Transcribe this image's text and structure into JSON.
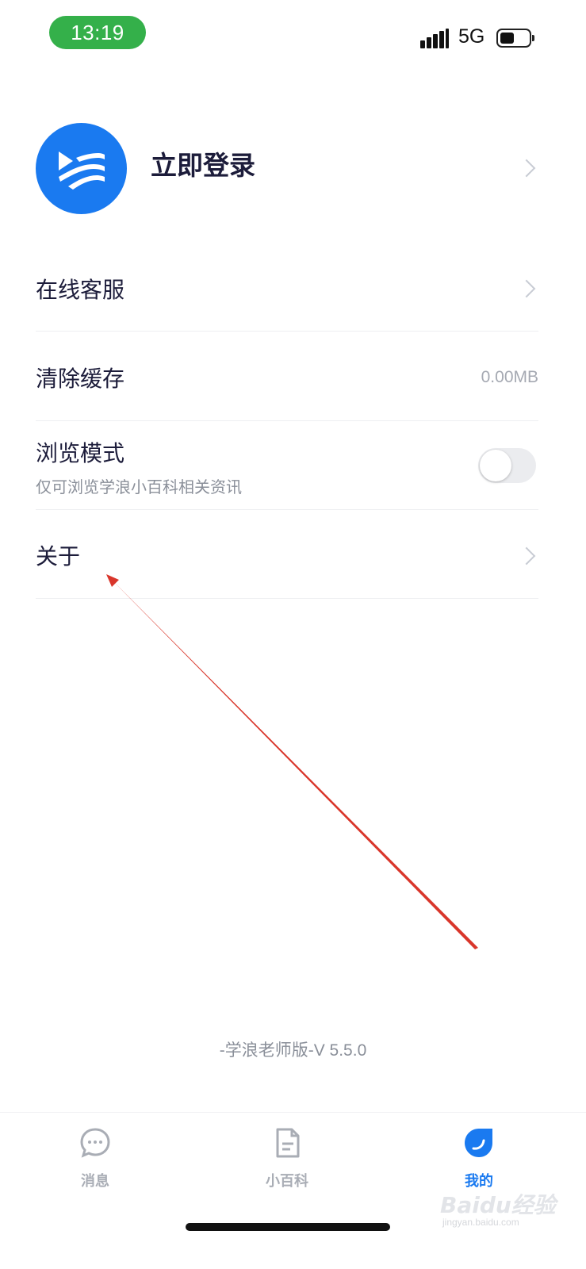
{
  "status_bar": {
    "time": "13:19",
    "network": "5G"
  },
  "profile": {
    "login_label": "立即登录"
  },
  "menu": {
    "online_service": {
      "label": "在线客服"
    },
    "clear_cache": {
      "label": "清除缓存",
      "value": "0.00MB"
    },
    "browse_mode": {
      "label": "浏览模式",
      "subtitle": "仅可浏览学浪小百科相关资讯",
      "enabled": false
    },
    "about": {
      "label": "关于"
    }
  },
  "version_text": "-学浪老师版-V 5.5.0",
  "tabbar": {
    "tabs": [
      {
        "label": "消息",
        "icon": "chat-bubble-icon",
        "active": false
      },
      {
        "label": "小百科",
        "icon": "document-icon",
        "active": false
      },
      {
        "label": "我的",
        "icon": "profile-drop-icon",
        "active": true
      }
    ]
  },
  "watermark": {
    "main": "Baidu经验",
    "sub": "jingyan.baidu.com"
  },
  "colors": {
    "accent": "#1a7af0",
    "status_time_bg": "#34b04a",
    "annotation_arrow": "#d9362b"
  }
}
